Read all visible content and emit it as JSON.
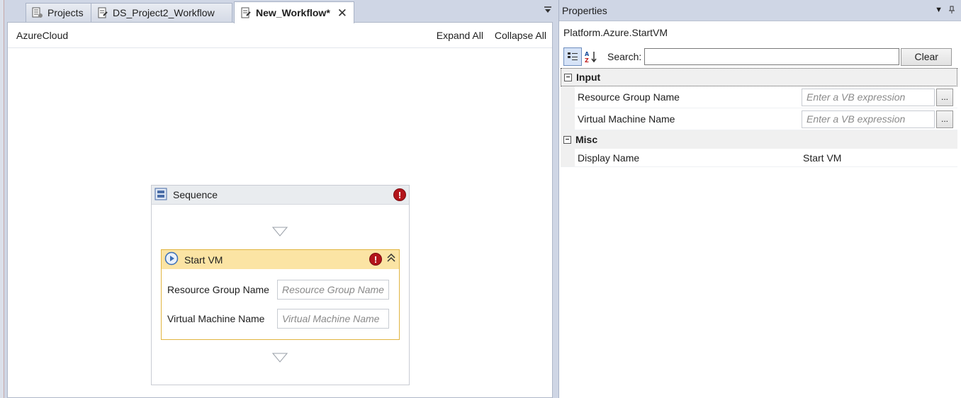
{
  "tabs": [
    {
      "label": "Projects",
      "icon": "projects-icon"
    },
    {
      "label": "DS_Project2_Workflow",
      "icon": "workflow-doc-icon"
    },
    {
      "label": "New_Workflow*",
      "icon": "workflow-doc-icon",
      "active": true
    }
  ],
  "designer": {
    "breadcrumb": "AzureCloud",
    "expand_all": "Expand All",
    "collapse_all": "Collapse All",
    "sequence": {
      "title": "Sequence",
      "activity": {
        "title": "Start VM",
        "fields": [
          {
            "label": "Resource Group Name",
            "placeholder": "Resource Group Name"
          },
          {
            "label": "Virtual Machine Name",
            "placeholder": "Virtual Machine Name"
          }
        ]
      }
    }
  },
  "properties": {
    "title": "Properties",
    "type_name": "Platform.Azure.StartVM",
    "search_label": "Search:",
    "search_value": "",
    "clear_label": "Clear",
    "categories": [
      {
        "name": "Input",
        "rows": [
          {
            "name": "Resource Group Name",
            "placeholder": "Enter a VB expression"
          },
          {
            "name": "Virtual Machine Name",
            "placeholder": "Enter a VB expression"
          }
        ]
      },
      {
        "name": "Misc",
        "rows": [
          {
            "name": "Display Name",
            "value": "Start VM"
          }
        ]
      }
    ]
  },
  "colors": {
    "error": "#b3151b",
    "activity_header": "#fbe4a4",
    "activity_border": "#e1b541"
  }
}
